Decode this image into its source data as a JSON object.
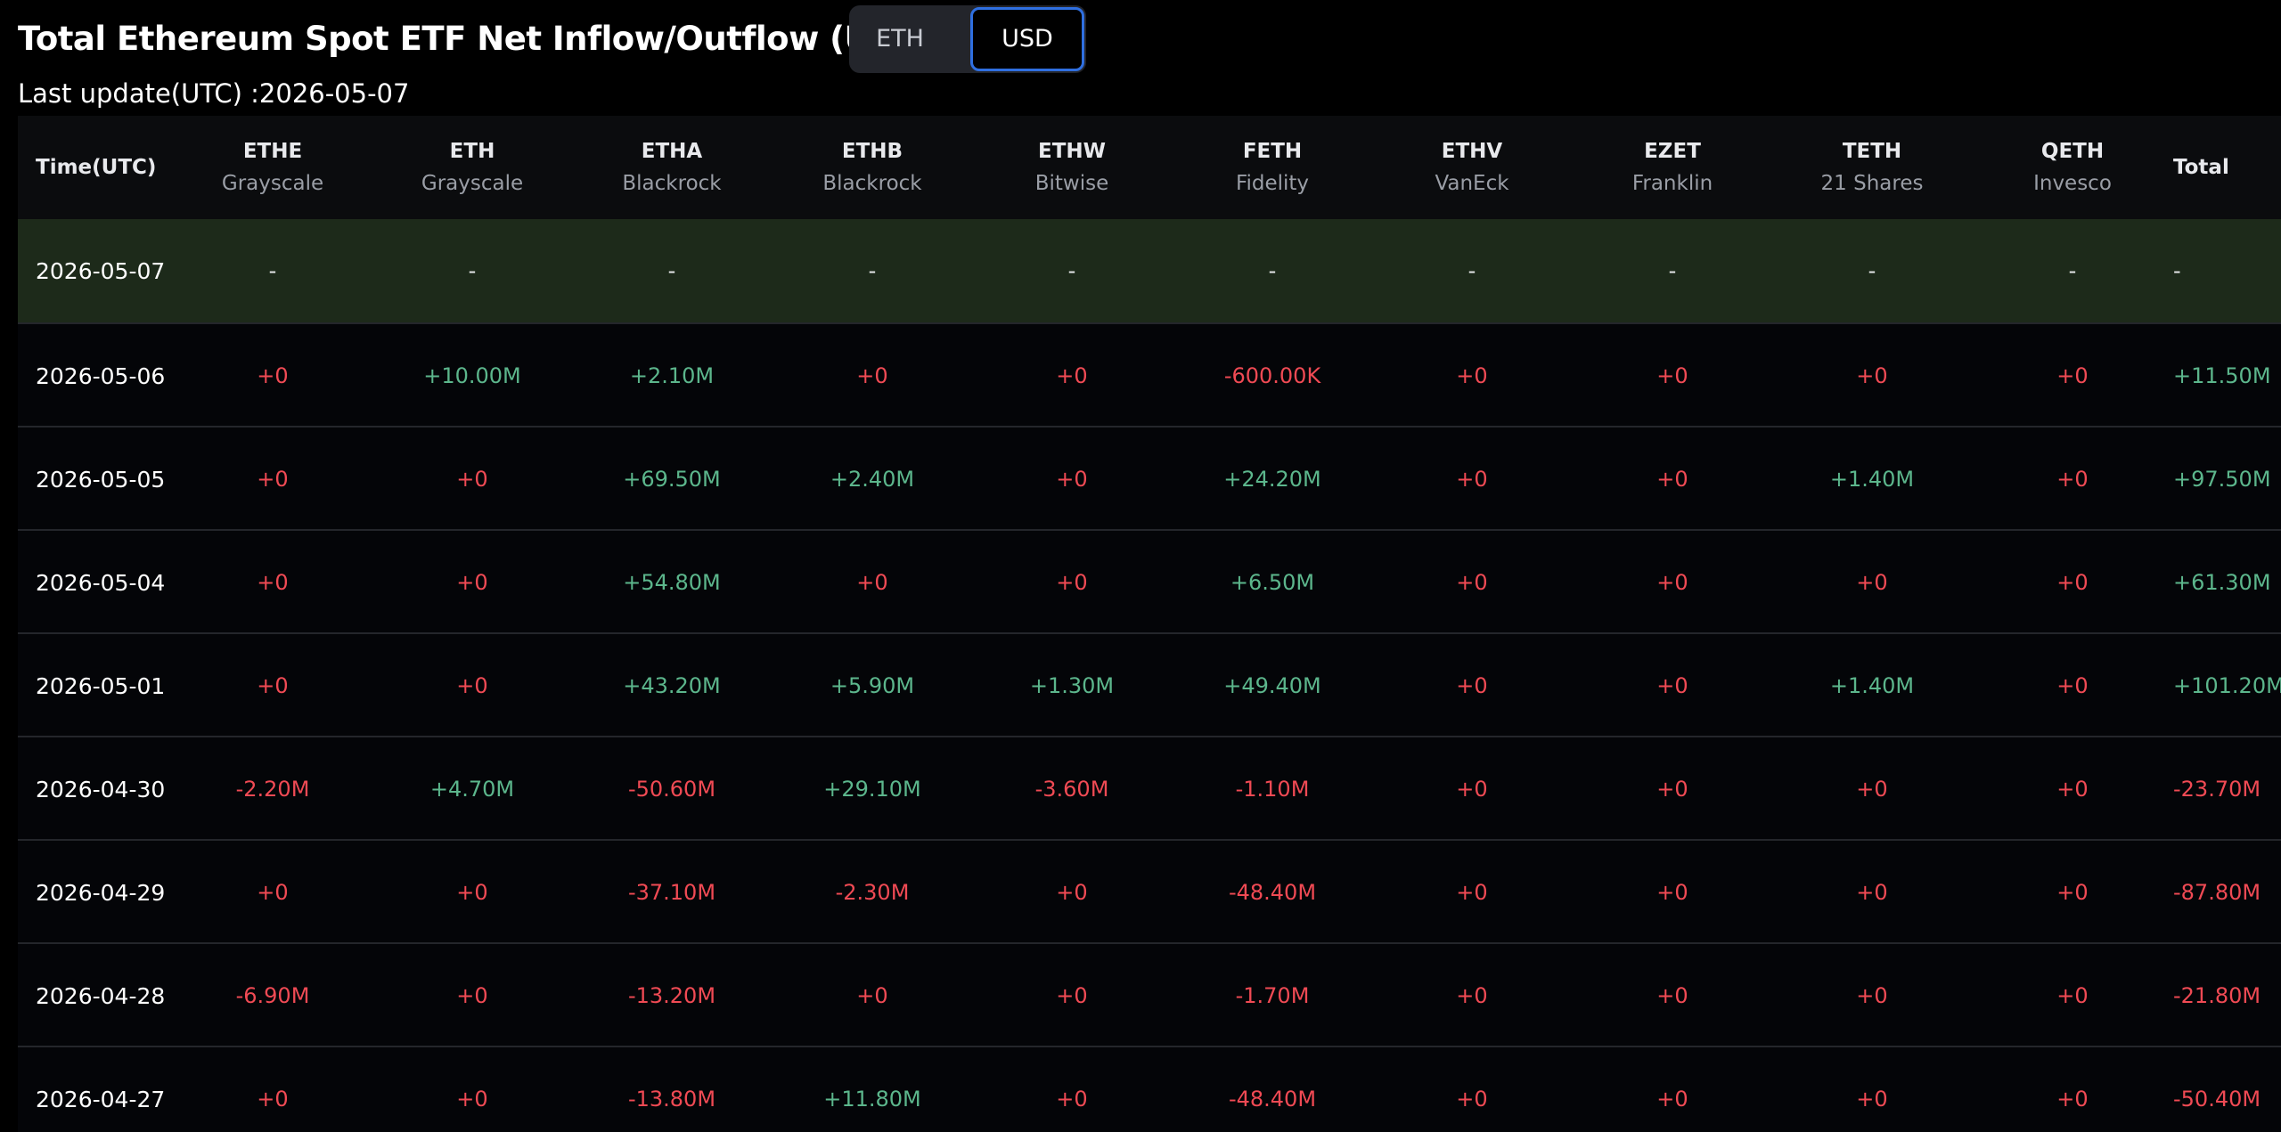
{
  "header": {
    "title": "Total Ethereum Spot ETF Net Inflow/Outflow (USD)",
    "toggle": {
      "eth_label": "ETH",
      "usd_label": "USD",
      "selected": "USD"
    },
    "last_update": "Last update(UTC) :2026-05-07"
  },
  "colors": {
    "positive": "#5cb68c",
    "negative": "#f04a54",
    "highlight_row": "#1d2a1a",
    "toggle_active_border": "#2f6fe0"
  },
  "table": {
    "time_header": "Time(UTC)",
    "total_header": "Total",
    "columns": [
      {
        "ticker": "ETHE",
        "issuer": "Grayscale"
      },
      {
        "ticker": "ETH",
        "issuer": "Grayscale"
      },
      {
        "ticker": "ETHA",
        "issuer": "Blackrock"
      },
      {
        "ticker": "ETHB",
        "issuer": "Blackrock"
      },
      {
        "ticker": "ETHW",
        "issuer": "Bitwise"
      },
      {
        "ticker": "FETH",
        "issuer": "Fidelity"
      },
      {
        "ticker": "ETHV",
        "issuer": "VanEck"
      },
      {
        "ticker": "EZET",
        "issuer": "Franklin"
      },
      {
        "ticker": "TETH",
        "issuer": "21 Shares"
      },
      {
        "ticker": "QETH",
        "issuer": "Invesco"
      }
    ],
    "rows": [
      {
        "date": "2026-05-07",
        "values": [
          "-",
          "-",
          "-",
          "-",
          "-",
          "-",
          "-",
          "-",
          "-",
          "-"
        ],
        "total": "-"
      },
      {
        "date": "2026-05-06",
        "values": [
          "+0",
          "+10.00M",
          "+2.10M",
          "+0",
          "+0",
          "-600.00K",
          "+0",
          "+0",
          "+0",
          "+0"
        ],
        "total": "+11.50M"
      },
      {
        "date": "2026-05-05",
        "values": [
          "+0",
          "+0",
          "+69.50M",
          "+2.40M",
          "+0",
          "+24.20M",
          "+0",
          "+0",
          "+1.40M",
          "+0"
        ],
        "total": "+97.50M"
      },
      {
        "date": "2026-05-04",
        "values": [
          "+0",
          "+0",
          "+54.80M",
          "+0",
          "+0",
          "+6.50M",
          "+0",
          "+0",
          "+0",
          "+0"
        ],
        "total": "+61.30M"
      },
      {
        "date": "2026-05-01",
        "values": [
          "+0",
          "+0",
          "+43.20M",
          "+5.90M",
          "+1.30M",
          "+49.40M",
          "+0",
          "+0",
          "+1.40M",
          "+0"
        ],
        "total": "+101.20M"
      },
      {
        "date": "2026-04-30",
        "values": [
          "-2.20M",
          "+4.70M",
          "-50.60M",
          "+29.10M",
          "-3.60M",
          "-1.10M",
          "+0",
          "+0",
          "+0",
          "+0"
        ],
        "total": "-23.70M"
      },
      {
        "date": "2026-04-29",
        "values": [
          "+0",
          "+0",
          "-37.10M",
          "-2.30M",
          "+0",
          "-48.40M",
          "+0",
          "+0",
          "+0",
          "+0"
        ],
        "total": "-87.80M"
      },
      {
        "date": "2026-04-28",
        "values": [
          "-6.90M",
          "+0",
          "-13.20M",
          "+0",
          "+0",
          "-1.70M",
          "+0",
          "+0",
          "+0",
          "+0"
        ],
        "total": "-21.80M"
      },
      {
        "date": "2026-04-27",
        "values": [
          "+0",
          "+0",
          "-13.80M",
          "+11.80M",
          "+0",
          "-48.40M",
          "+0",
          "+0",
          "+0",
          "+0"
        ],
        "total": "-50.40M"
      }
    ]
  }
}
